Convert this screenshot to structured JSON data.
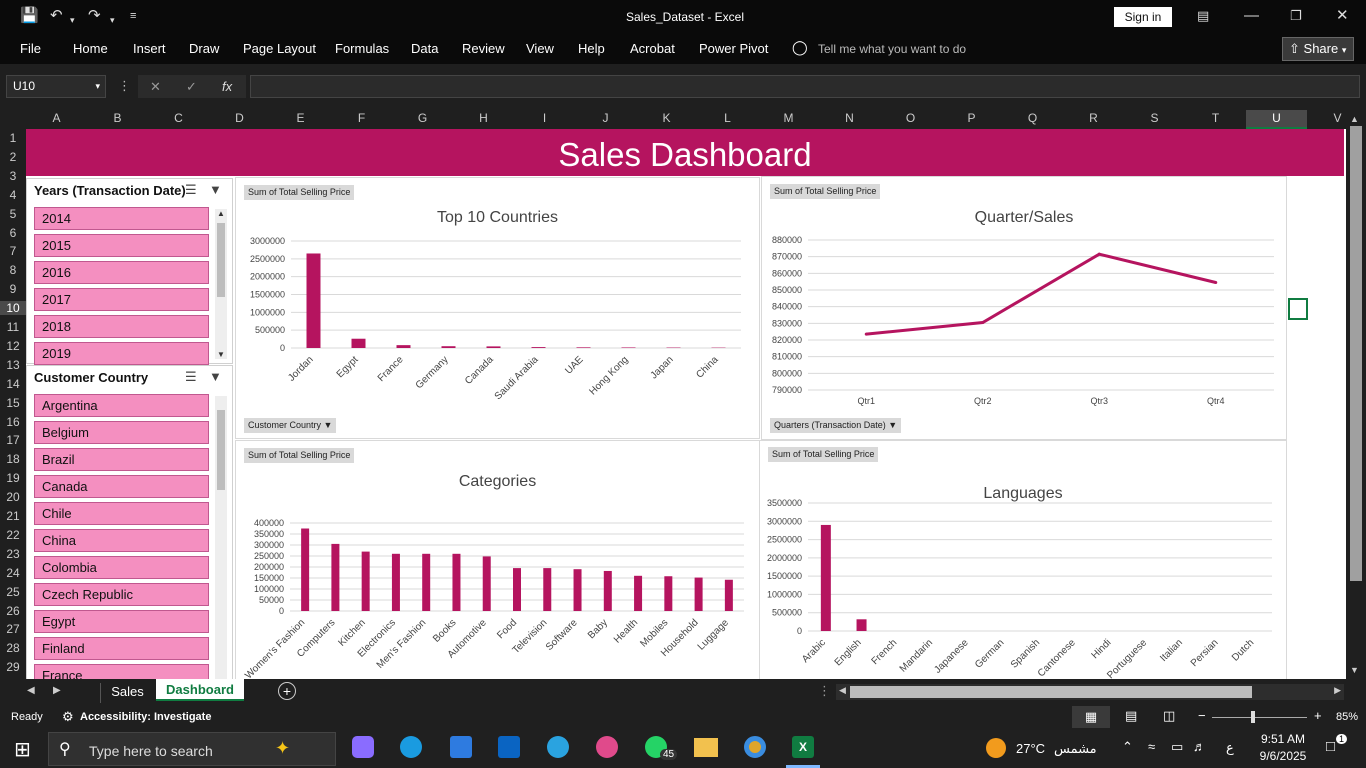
{
  "app": {
    "doc_title": "Sales_Dataset - Excel",
    "signin": "Sign in",
    "share": "Share"
  },
  "ribbon": {
    "tabs": [
      "File",
      "Home",
      "Insert",
      "Draw",
      "Page Layout",
      "Formulas",
      "Data",
      "Review",
      "View",
      "Help",
      "Acrobat",
      "Power Pivot"
    ],
    "tellme": "Tell me what you want to do"
  },
  "formula": {
    "namebox": "U10",
    "value": ""
  },
  "columns": [
    "A",
    "B",
    "C",
    "D",
    "E",
    "F",
    "G",
    "H",
    "I",
    "J",
    "K",
    "L",
    "M",
    "N",
    "O",
    "P",
    "Q",
    "R",
    "S",
    "T",
    "U",
    "V"
  ],
  "rows": [
    "1",
    "2",
    "3",
    "4",
    "5",
    "6",
    "7",
    "8",
    "9",
    "10",
    "11",
    "12",
    "13",
    "14",
    "15",
    "16",
    "17",
    "18",
    "19",
    "20",
    "21",
    "22",
    "23",
    "24",
    "25",
    "26",
    "27",
    "28",
    "29"
  ],
  "dashboard": {
    "title": "Sales Dashboard"
  },
  "slicer_years": {
    "title": "Years (Transaction Date)",
    "items": [
      "2014",
      "2015",
      "2016",
      "2017",
      "2018",
      "2019"
    ]
  },
  "slicer_country": {
    "title": "Customer Country",
    "items": [
      "Argentina",
      "Belgium",
      "Brazil",
      "Canada",
      "Chile",
      "China",
      "Colombia",
      "Czech Republic",
      "Egypt",
      "Finland",
      "France"
    ]
  },
  "field_buttons": {
    "sum": "Sum of Total Selling Price",
    "country": "Customer Country",
    "quarters": "Quarters (Transaction Date)"
  },
  "chart_data": [
    {
      "id": "countries",
      "type": "bar",
      "title": "Top 10 Countries",
      "categories": [
        "Jordan",
        "Egypt",
        "France",
        "Germany",
        "Canada",
        "Saudi Arabia",
        "UAE",
        "Hong Kong",
        "Japan",
        "China"
      ],
      "values": [
        2650000,
        260000,
        80000,
        50000,
        45000,
        25000,
        18000,
        15000,
        12000,
        10000
      ],
      "ylim": [
        0,
        3000000
      ],
      "yticks": [
        0,
        500000,
        1000000,
        1500000,
        2000000,
        2500000,
        3000000
      ],
      "color": "#b5145f"
    },
    {
      "id": "quarters",
      "type": "line",
      "title": "Quarter/Sales",
      "categories": [
        "Qtr1",
        "Qtr2",
        "Qtr3",
        "Qtr4"
      ],
      "values": [
        823500,
        830500,
        871500,
        854500
      ],
      "ylim": [
        790000,
        880000
      ],
      "yticks": [
        790000,
        800000,
        810000,
        820000,
        830000,
        840000,
        850000,
        860000,
        870000,
        880000
      ],
      "color": "#b5145f"
    },
    {
      "id": "categories",
      "type": "bar",
      "title": "Categories",
      "categories": [
        "Women's Fashion",
        "Computers",
        "Kitchen",
        "Electronics",
        "Men's Fashion",
        "Books",
        "Automotive",
        "Food",
        "Television",
        "Software",
        "Baby",
        "Health",
        "Mobiles",
        "Household",
        "Luggage"
      ],
      "values": [
        375000,
        305000,
        270000,
        260000,
        260000,
        260000,
        248000,
        195000,
        195000,
        190000,
        182000,
        160000,
        158000,
        152000,
        142000
      ],
      "ylim": [
        0,
        400000
      ],
      "yticks": [
        0,
        50000,
        100000,
        150000,
        200000,
        250000,
        300000,
        350000,
        400000
      ],
      "color": "#b5145f"
    },
    {
      "id": "languages",
      "type": "bar",
      "title": "Languages",
      "categories": [
        "Arabic",
        "English",
        "French",
        "Mandarin",
        "Japanese",
        "German",
        "Spanish",
        "Cantonese",
        "Hindi",
        "Portuguese",
        "Italian",
        "Persian",
        "Dutch"
      ],
      "values": [
        2900000,
        320000,
        0,
        0,
        0,
        0,
        0,
        0,
        0,
        0,
        0,
        0,
        0
      ],
      "ylim": [
        0,
        3500000
      ],
      "yticks": [
        0,
        500000,
        1000000,
        1500000,
        2000000,
        2500000,
        3000000,
        3500000
      ],
      "color": "#b5145f"
    }
  ],
  "sheets": {
    "tabs": [
      "Sales",
      "Dashboard"
    ],
    "active": "Dashboard"
  },
  "status": {
    "ready": "Ready",
    "accessibility": "Accessibility: Investigate",
    "zoom": "85%"
  },
  "taskbar": {
    "search": "Type here to search",
    "weather": "27°C",
    "weather_text": "مشمس",
    "time": "9:51 AM",
    "date": "9/6/2025",
    "lang": "ع",
    "badge": "45",
    "notif": "1"
  },
  "colors": {
    "accent": "#b5145f",
    "slicer_item": "#f48fc0"
  }
}
